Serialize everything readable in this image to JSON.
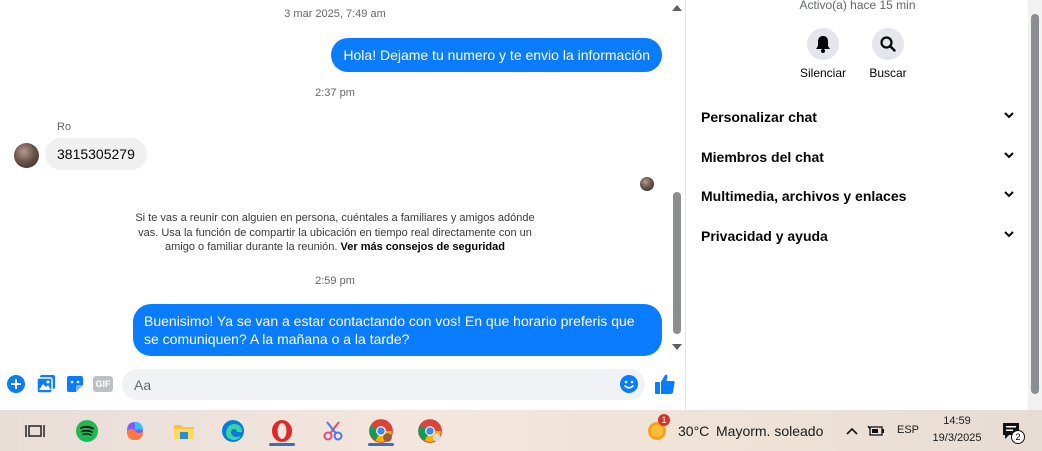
{
  "chat": {
    "timestamp_1": "3 mar 2025, 7:49 am",
    "msg_out_1": "Hola! Dejame tu numero y te envio la información",
    "timestamp_2": "2:37 pm",
    "sender_name": "Ro",
    "msg_in_1": "3815305279",
    "safety_text": "Si te vas a reunir con alguien en persona, cuéntales a familiares y amigos adónde vas. Usa la función de compartir la ubicación en tiempo real directamente con un amigo o familiar durante la reunión.",
    "safety_link": "Ver más consejos de seguridad",
    "timestamp_3": "2:59 pm",
    "msg_out_2": "Buenisimo! Ya se van a estar contactando con vos! En que horario preferis que se comuniquen? A la mañana o a la tarde?"
  },
  "composer": {
    "placeholder": "Aa"
  },
  "side_panel": {
    "status": "Activo(a) hace 15 min",
    "mute_label": "Silenciar",
    "search_label": "Buscar",
    "sections": [
      {
        "label": "Personalizar chat"
      },
      {
        "label": "Miembros del chat"
      },
      {
        "label": "Multimedia, archivos y enlaces"
      },
      {
        "label": "Privacidad y ayuda"
      }
    ]
  },
  "taskbar": {
    "weather_badge": "1",
    "temperature": "30°C",
    "weather": "Mayorm. soleado",
    "language": "ESP",
    "time": "14:59",
    "date": "19/3/2025",
    "notification_count": "2"
  },
  "colors": {
    "messenger_blue": "#0a7cff",
    "incoming_bubble": "#f0f0f0"
  }
}
